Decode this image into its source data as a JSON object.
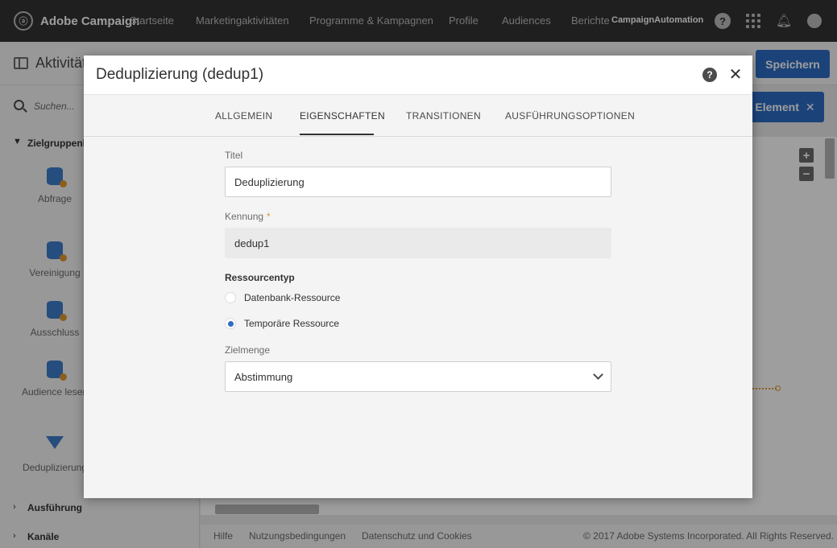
{
  "topnav": {
    "brand": "Adobe Campaign",
    "items": [
      "Startseite",
      "Marketingaktivitäten",
      "Programme & Kampagnen",
      "Profile",
      "Audiences",
      "Berichte"
    ],
    "user": "CampaignAutomation"
  },
  "background": {
    "page_title": "Aktivität",
    "save_label": "Speichern",
    "element_label": "Element",
    "search_placeholder": "Suchen...",
    "sections": [
      "Zielgruppenb",
      "Ausführung",
      "Kanäle"
    ],
    "tools": [
      "Abfrage",
      "Vereinigung",
      "Ausschluss",
      "Audience lesen",
      "Deduplizierung"
    ],
    "footer": {
      "help": "Hilfe",
      "terms": "Nutzungsbedingungen",
      "privacy": "Datenschutz und Cookies",
      "copyright": "© 2017 Adobe Systems Incorporated. All Rights Reserved."
    }
  },
  "dialog": {
    "title": "Deduplizierung (dedup1)",
    "tabs": [
      "ALLGEMEIN",
      "EIGENSCHAFTEN",
      "TRANSITIONEN",
      "AUSFÜHRUNGSOPTIONEN"
    ],
    "active_tab": "EIGENSCHAFTEN",
    "fields": {
      "title_label": "Titel",
      "title_value": "Deduplizierung",
      "id_label": "Kennung",
      "id_required_mark": "*",
      "id_value": "dedup1",
      "resource_label": "Ressourcentyp",
      "resource_options": [
        "Datenbank-Ressource",
        "Temporäre Ressource"
      ],
      "resource_selected": "Temporäre Ressource",
      "target_label": "Zielmenge",
      "target_value": "Abstimmung"
    }
  },
  "colors": {
    "nav_bg": "#323232",
    "accent_blue": "#2d6cc5",
    "accent_orange": "#e09a2d"
  }
}
